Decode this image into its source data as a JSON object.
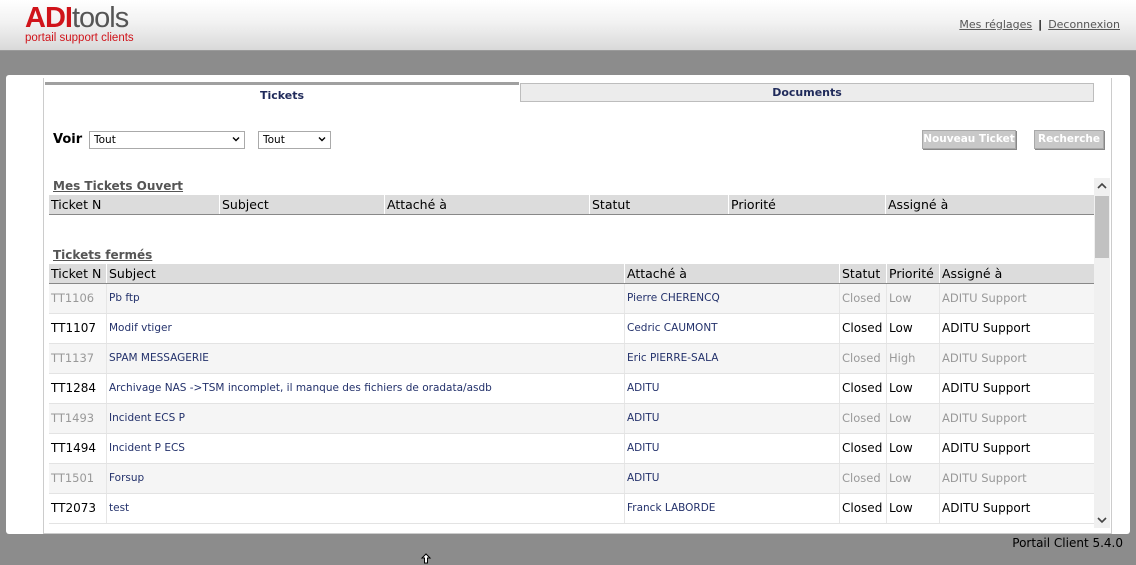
{
  "header": {
    "logo_adi": "ADI",
    "logo_tools": "tools",
    "logo_tagline": "portail support clients",
    "settings_link": "Mes réglages",
    "separator": "|",
    "logout_link": "Deconnexion"
  },
  "tabs": [
    {
      "label": "Tickets",
      "active": true
    },
    {
      "label": "Documents",
      "active": false
    }
  ],
  "filters": {
    "voir_label": "Voir",
    "filter1_value": "Tout",
    "filter2_value": "Tout"
  },
  "buttons": {
    "new_ticket": "Nouveau Ticket",
    "search": "Recherche"
  },
  "open_tickets": {
    "title": "Mes Tickets Ouvert",
    "columns": [
      "Ticket N",
      "Subject",
      "Attaché à",
      "Statut",
      "Priorité",
      "Assigné à"
    ]
  },
  "closed_tickets": {
    "title": "Tickets fermés",
    "columns": [
      "Ticket N",
      "Subject",
      "Attaché à",
      "Statut",
      "Priorité",
      "Assigné à"
    ],
    "rows": [
      {
        "num": "TT1106",
        "subject": "Pb ftp",
        "attached": "Pierre CHERENCQ",
        "status": "Closed",
        "priority": "Low",
        "assigned": "ADITU Support",
        "dim": true
      },
      {
        "num": "TT1107",
        "subject": "Modif vtiger",
        "attached": "Cedric CAUMONT",
        "status": "Closed",
        "priority": "Low",
        "assigned": "ADITU Support",
        "dim": false
      },
      {
        "num": "TT1137",
        "subject": "SPAM MESSAGERIE",
        "attached": "Eric PIERRE-SALA",
        "status": "Closed",
        "priority": "High",
        "assigned": "ADITU Support",
        "dim": true
      },
      {
        "num": "TT1284",
        "subject": "Archivage NAS ->TSM incomplet, il manque des fichiers de oradata/asdb",
        "attached": "ADITU",
        "status": "Closed",
        "priority": "Low",
        "assigned": "ADITU Support",
        "dim": false
      },
      {
        "num": "TT1493",
        "subject": "Incident ECS P",
        "attached": "ADITU",
        "status": "Closed",
        "priority": "Low",
        "assigned": "ADITU Support",
        "dim": true
      },
      {
        "num": "TT1494",
        "subject": "Incident P ECS",
        "attached": "ADITU",
        "status": "Closed",
        "priority": "Low",
        "assigned": "ADITU Support",
        "dim": false
      },
      {
        "num": "TT1501",
        "subject": "Forsup",
        "attached": "ADITU",
        "status": "Closed",
        "priority": "Low",
        "assigned": "ADITU Support",
        "dim": true
      },
      {
        "num": "TT2073",
        "subject": "test",
        "attached": "Franck LABORDE",
        "status": "Closed",
        "priority": "Low",
        "assigned": "ADITU Support",
        "dim": false
      }
    ]
  },
  "footer": {
    "version": "Portail Client 5.4.0"
  }
}
